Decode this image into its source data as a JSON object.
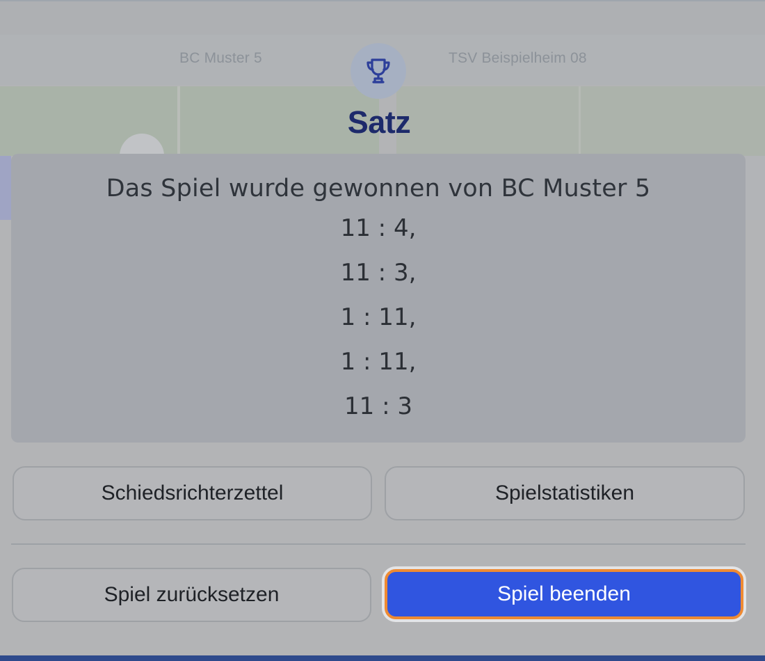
{
  "scoreboard": {
    "team_home": "BC Muster 5",
    "team_away": "TSV Beispielheim 08"
  },
  "dialog": {
    "icon": "trophy-icon",
    "title": "Satz",
    "winner_text": "Das Spiel wurde gewonnen von BC Muster 5",
    "set_scores": [
      "11 : 4,",
      "11 : 3,",
      "1 : 11,",
      "1 : 11,",
      "11 : 3"
    ]
  },
  "buttons": {
    "referee_sheet": "Schiedsrichterzettel",
    "match_stats": "Spielstatistiken",
    "reset_match": "Spiel zurücksetzen",
    "end_match": "Spiel beenden"
  },
  "colors": {
    "title": "#1d2a6b",
    "primary_button": "#3055e0",
    "focus_ring": "#ee8a33"
  }
}
